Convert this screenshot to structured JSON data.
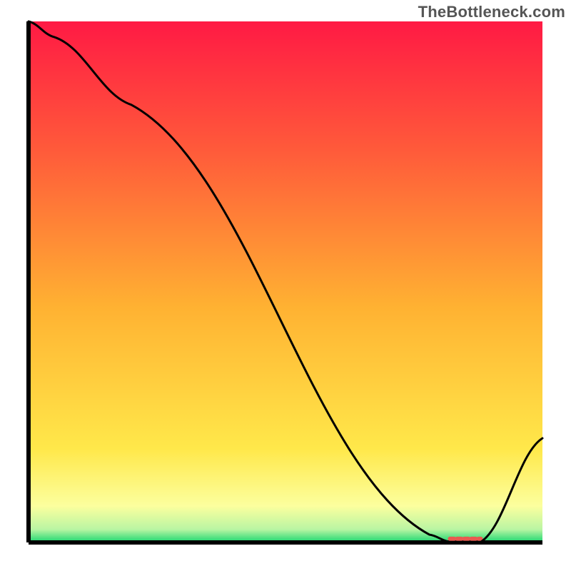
{
  "watermark": "TheBottleneck.com",
  "chart_data": {
    "type": "line",
    "title": "",
    "xlabel": "",
    "ylabel": "",
    "xlim": [
      0,
      100
    ],
    "ylim": [
      0,
      100
    ],
    "grid": false,
    "x": [
      0,
      5,
      20,
      78,
      82,
      88,
      100
    ],
    "y": [
      100,
      97,
      84,
      1.5,
      0.1,
      0.1,
      20
    ],
    "note": "curve values read off as percentage of plot height; minimum plateau ~x 82-88",
    "background_gradient": {
      "stops": [
        {
          "pos": 0.0,
          "color": "#ff1a44"
        },
        {
          "pos": 0.25,
          "color": "#ff5b3a"
        },
        {
          "pos": 0.55,
          "color": "#ffb232"
        },
        {
          "pos": 0.82,
          "color": "#ffe84a"
        },
        {
          "pos": 0.93,
          "color": "#fcff9e"
        },
        {
          "pos": 0.975,
          "color": "#b9f5a3"
        },
        {
          "pos": 1.0,
          "color": "#18d66f"
        }
      ]
    },
    "marker_region": {
      "xstart": 82,
      "xend": 88,
      "y": 0.7,
      "color": "#e85a50"
    }
  },
  "plot": {
    "outer_w": 800,
    "outer_h": 800,
    "inner_x": 40,
    "inner_y": 30,
    "inner_w": 720,
    "inner_h": 730
  }
}
